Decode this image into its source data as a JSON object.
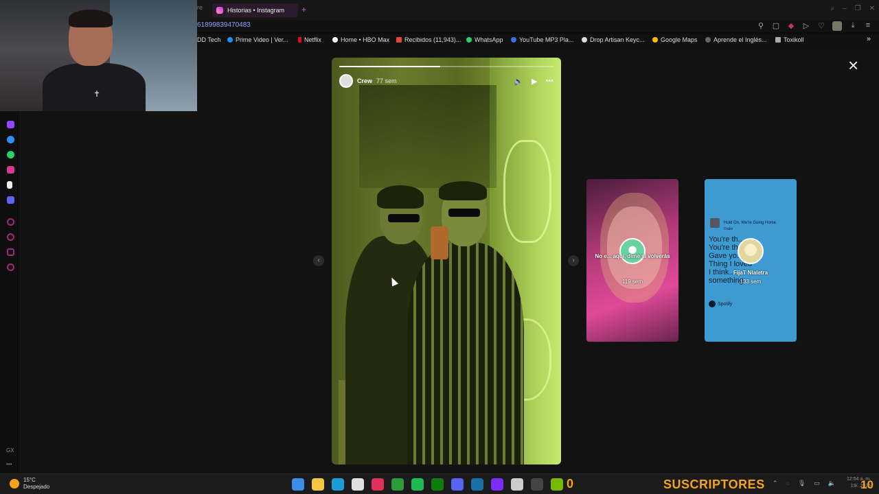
{
  "browser": {
    "prev_tab": "re",
    "active_tab": "Historias • Instagram",
    "new_tab": "+",
    "address": "61899839470483",
    "bookmarks": [
      {
        "label": "DD Tech",
        "color": "#777777"
      },
      {
        "label": "Prime Video | Ver...",
        "color": "#1e8fff"
      },
      {
        "label": "Netflix",
        "color": "#e50914"
      },
      {
        "label": "Home • HBO Max",
        "color": "#ffffff"
      },
      {
        "label": "Recibidos (11,943)...",
        "color": "#ea4335"
      },
      {
        "label": "WhatsApp",
        "color": "#25d366"
      },
      {
        "label": "YouTube MP3 Pla...",
        "color": "#3b6fe0"
      },
      {
        "label": "Drop Artisan Keyc...",
        "color": "#dddddd"
      },
      {
        "label": "Google Maps",
        "color": "#fbbc04"
      },
      {
        "label": "Aprende el Inglés...",
        "color": "#666666"
      },
      {
        "label": "Toxikoll",
        "color": "#aaaaaa"
      }
    ]
  },
  "sidebar": {
    "icons": [
      {
        "name": "twitch-icon",
        "color": "#9146ff"
      },
      {
        "name": "messenger-icon",
        "color": "#2f8cff"
      },
      {
        "name": "whatsapp-icon",
        "color": "#25d366"
      },
      {
        "name": "instagram-icon",
        "color": "#d83a8f"
      },
      {
        "name": "tiktok-icon",
        "color": "#eeeeee"
      },
      {
        "name": "discord-icon",
        "color": "#5865f2"
      },
      {
        "name": "player-icon",
        "color": "#a02a7a"
      },
      {
        "name": "history-icon",
        "color": "#a02a7a"
      },
      {
        "name": "extensions-icon",
        "color": "#a02a7a"
      },
      {
        "name": "settings-icon",
        "color": "#a02a7a"
      }
    ],
    "bottom_label": "GX"
  },
  "story": {
    "user": "Crew",
    "time": "77 sem",
    "progress": 0.47
  },
  "previews": [
    {
      "caption": "No e... aquí, dime si volverás",
      "time": "119 sem"
    },
    {
      "name": "FijaT Nlaletra",
      "time": "133 sem",
      "song": "Hold On, We're Going Home",
      "artist": "Drake",
      "lyrics": [
        "You're th...",
        "You're th...",
        "Gave yo...y",
        "Thing I loved",
        "I think...",
        "something"
      ],
      "brand": "Spotify"
    }
  ],
  "close_icon": "×",
  "taskbar": {
    "temp": "15°C",
    "weather": "Despejado",
    "counter": "0",
    "subs_label": "SUSCRIPTORES",
    "big_digit": "10",
    "clock_time": "12:54 a. m.",
    "clock_date": "19/..2025"
  },
  "taskbar_apps": [
    {
      "name": "windows-start-icon",
      "color": "#3c8fe8"
    },
    {
      "name": "file-explorer-icon",
      "color": "#f3c744"
    },
    {
      "name": "edge-icon",
      "color": "#1d9bd8"
    },
    {
      "name": "store-icon",
      "color": "#e0e0e0"
    },
    {
      "name": "opera-gx-icon",
      "color": "#e0305a"
    },
    {
      "name": "xbox-app-icon",
      "color": "#2d9b3c"
    },
    {
      "name": "spotify-icon",
      "color": "#1db954"
    },
    {
      "name": "xbox-icon",
      "color": "#107c10"
    },
    {
      "name": "discord-taskbar-icon",
      "color": "#5865f2"
    },
    {
      "name": "steam-icon",
      "color": "#1b6fa8"
    },
    {
      "name": "purple-app-icon",
      "color": "#7b2cff"
    },
    {
      "name": "clock-app-icon",
      "color": "#cccccc"
    },
    {
      "name": "epic-games-icon",
      "color": "#444444"
    },
    {
      "name": "nvidia-icon",
      "color": "#76b900"
    }
  ]
}
